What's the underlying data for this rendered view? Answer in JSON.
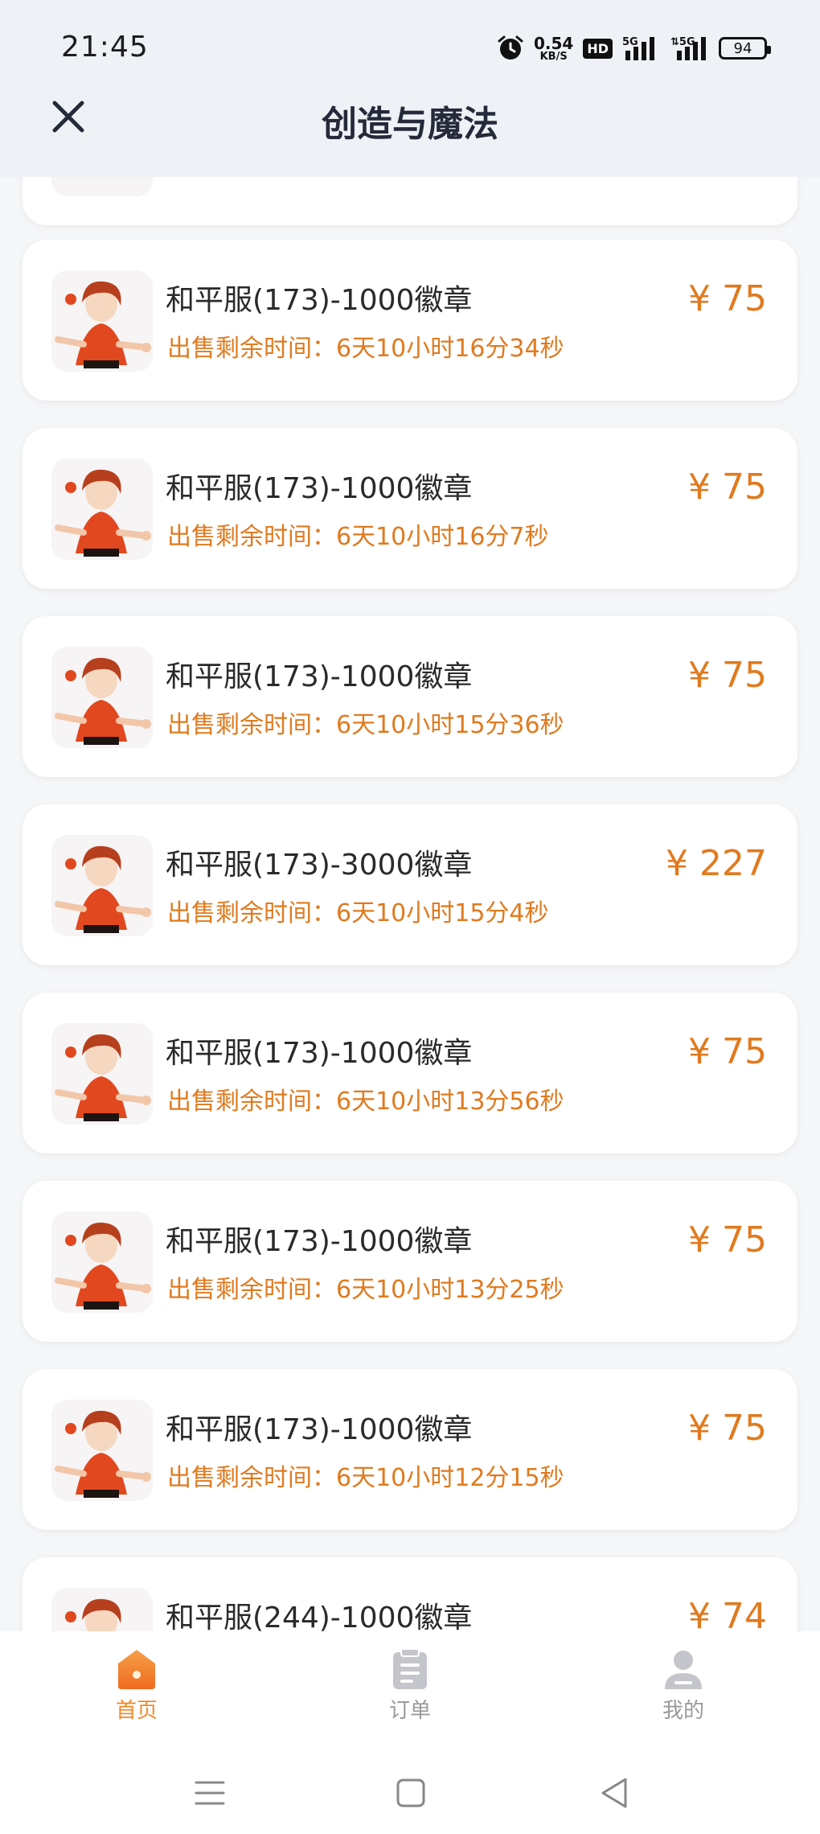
{
  "status": {
    "time": "21:45",
    "net_speed_value": "0.54",
    "net_speed_unit": "KB/S",
    "hd": "HD",
    "battery": "94"
  },
  "header": {
    "title": "创造与魔法"
  },
  "items": [
    {
      "name": "和平服(173)-1000徽章",
      "time": "出售剩余时间：6天10小时16分34秒",
      "price": "¥ 75"
    },
    {
      "name": "和平服(173)-1000徽章",
      "time": "出售剩余时间：6天10小时16分7秒",
      "price": "¥ 75"
    },
    {
      "name": "和平服(173)-1000徽章",
      "time": "出售剩余时间：6天10小时15分36秒",
      "price": "¥ 75"
    },
    {
      "name": "和平服(173)-3000徽章",
      "time": "出售剩余时间：6天10小时15分4秒",
      "price": "¥ 227"
    },
    {
      "name": "和平服(173)-1000徽章",
      "time": "出售剩余时间：6天10小时13分56秒",
      "price": "¥ 75"
    },
    {
      "name": "和平服(173)-1000徽章",
      "time": "出售剩余时间：6天10小时13分25秒",
      "price": "¥ 75"
    },
    {
      "name": "和平服(173)-1000徽章",
      "time": "出售剩余时间：6天10小时12分15秒",
      "price": "¥ 75"
    },
    {
      "name": "和平服(244)-1000徽章",
      "time": "",
      "price": "¥ 74"
    }
  ],
  "tabs": [
    {
      "label": "首页",
      "icon": "home-icon",
      "active": true
    },
    {
      "label": "订单",
      "icon": "order-icon",
      "active": false
    },
    {
      "label": "我的",
      "icon": "profile-icon",
      "active": false
    }
  ],
  "colors": {
    "accent": "#e07a1f",
    "tab_active": "#f08a2a",
    "background": "#f5f6f8"
  }
}
